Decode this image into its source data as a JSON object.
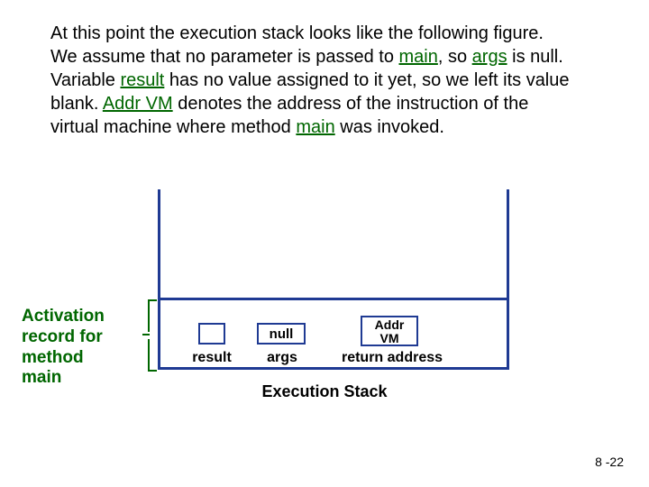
{
  "paragraph": {
    "t1": "At this point the execution stack looks like the following figure. We assume that no parameter is passed to ",
    "kw1": "main",
    "t2": ", so ",
    "kw2": "args",
    "t3": " is null. Variable ",
    "kw3": "result",
    "t4": " has no value assigned to it yet, so we left its value blank. ",
    "kw4": "Addr VM",
    "t5": " denotes the address of the instruction of the virtual machine where method ",
    "kw5": "main",
    "t6": " was invoked."
  },
  "diagram": {
    "result_value": "",
    "args_value": "null",
    "addr_line1": "Addr",
    "addr_line2": "VM",
    "result_label": "result",
    "args_label": "args",
    "return_label": "return address",
    "stack_label": "Execution Stack"
  },
  "activation": {
    "l1": "Activation",
    "l2": "record for",
    "l3": "method",
    "l4": "main"
  },
  "page_number": "8 -22"
}
